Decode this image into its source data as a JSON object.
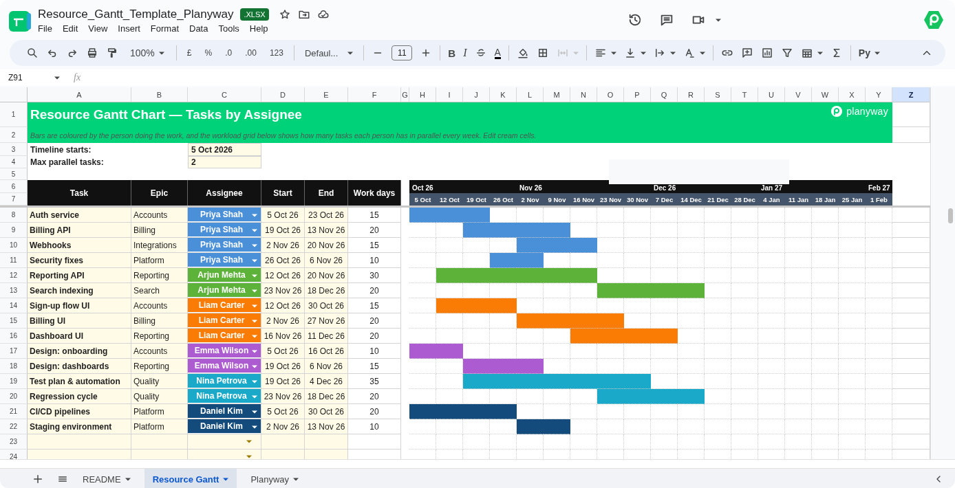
{
  "app": {
    "title": "Resource_Gantt_Template_Planyway",
    "badge": ".XLSX",
    "menu": [
      "File",
      "Edit",
      "View",
      "Insert",
      "Format",
      "Data",
      "Tools",
      "Help"
    ]
  },
  "toolbar": {
    "zoom": "100%",
    "currency": "£",
    "percent": "%",
    "decrease_decimals": ".0",
    "increase_decimals": ".00",
    "number_format": "123",
    "font": "Defaul...",
    "font_size": "11",
    "bold": "B",
    "italic": "I",
    "text_color": "A",
    "addon": "Py"
  },
  "formula_bar": {
    "cell": "Z91",
    "fx": "fx"
  },
  "columns": [
    {
      "label": "A",
      "selected": false
    },
    {
      "label": "B",
      "selected": false
    },
    {
      "label": "C",
      "selected": false
    },
    {
      "label": "D",
      "selected": false
    },
    {
      "label": "E",
      "selected": false
    },
    {
      "label": "F",
      "selected": false
    },
    {
      "label": "G",
      "selected": false
    },
    {
      "label": "H",
      "selected": false
    },
    {
      "label": "I",
      "selected": false
    },
    {
      "label": "J",
      "selected": false
    },
    {
      "label": "K",
      "selected": false
    },
    {
      "label": "L",
      "selected": false
    },
    {
      "label": "M",
      "selected": false
    },
    {
      "label": "N",
      "selected": false
    },
    {
      "label": "O",
      "selected": false
    },
    {
      "label": "P",
      "selected": false
    },
    {
      "label": "Q",
      "selected": false
    },
    {
      "label": "R",
      "selected": false
    },
    {
      "label": "S",
      "selected": false
    },
    {
      "label": "T",
      "selected": false
    },
    {
      "label": "U",
      "selected": false
    },
    {
      "label": "V",
      "selected": false
    },
    {
      "label": "W",
      "selected": false
    },
    {
      "label": "X",
      "selected": false
    },
    {
      "label": "Y",
      "selected": false
    },
    {
      "label": "Z",
      "selected": true
    }
  ],
  "row_numbers": [
    "1",
    "2",
    "3",
    "4",
    "5",
    "6",
    "7",
    "8",
    "9",
    "10",
    "11",
    "12",
    "13",
    "14",
    "15",
    "16",
    "17",
    "18",
    "19",
    "20",
    "21",
    "22",
    "23",
    "24"
  ],
  "sheet": {
    "title": "Resource Gantt Chart — Tasks by Assignee",
    "brand": "planyway",
    "subtitle": "Bars are coloured by the person doing the work, and the workload grid below shows how many tasks each person has in parallel every week. Edit cream cells.",
    "settings": [
      {
        "label": "Timeline starts:",
        "value": "5 Oct 2026"
      },
      {
        "label": "Max parallel tasks:",
        "value": "2"
      }
    ],
    "headers": [
      "Task",
      "Epic",
      "Assignee",
      "Start",
      "End",
      "Work days"
    ],
    "weeks": [
      {
        "label": "5 Oct",
        "month": "Oct 26"
      },
      {
        "label": "12 Oct"
      },
      {
        "label": "19 Oct"
      },
      {
        "label": "26 Oct"
      },
      {
        "label": "2 Nov",
        "month": "Nov 26"
      },
      {
        "label": "9 Nov"
      },
      {
        "label": "16 Nov"
      },
      {
        "label": "23 Nov"
      },
      {
        "label": "30 Nov"
      },
      {
        "label": "7 Dec",
        "month": "Dec 26"
      },
      {
        "label": "14 Dec"
      },
      {
        "label": "21 Dec"
      },
      {
        "label": "28 Dec"
      },
      {
        "label": "4 Jan",
        "month": "Jan 27"
      },
      {
        "label": "11 Jan"
      },
      {
        "label": "18 Jan"
      },
      {
        "label": "25 Jan"
      },
      {
        "label": "1 Feb",
        "month": "Feb 27"
      }
    ],
    "tasks": [
      {
        "kind": "task",
        "task": "Auth service",
        "epic": "Accounts",
        "assignee": "Priya Shah",
        "color": "#4a90d9",
        "start": "5 Oct 26",
        "end": "23 Oct 26",
        "work_days": "15",
        "bar": [
          true,
          true,
          true,
          false,
          false,
          false,
          false,
          false,
          false,
          false,
          false,
          false,
          false,
          false,
          false,
          false,
          false,
          false
        ]
      },
      {
        "kind": "task",
        "task": "Billing API",
        "epic": "Billing",
        "assignee": "Priya Shah",
        "color": "#4a90d9",
        "start": "19 Oct 26",
        "end": "13 Nov 26",
        "work_days": "20",
        "bar": [
          false,
          false,
          true,
          true,
          true,
          true,
          false,
          false,
          false,
          false,
          false,
          false,
          false,
          false,
          false,
          false,
          false,
          false
        ]
      },
      {
        "kind": "task",
        "task": "Webhooks",
        "epic": "Integrations",
        "assignee": "Priya Shah",
        "color": "#4a90d9",
        "start": "2 Nov 26",
        "end": "20 Nov 26",
        "work_days": "15",
        "bar": [
          false,
          false,
          false,
          false,
          true,
          true,
          true,
          false,
          false,
          false,
          false,
          false,
          false,
          false,
          false,
          false,
          false,
          false
        ]
      },
      {
        "kind": "task",
        "task": "Security fixes",
        "epic": "Platform",
        "assignee": "Priya Shah",
        "color": "#4a90d9",
        "start": "26 Oct 26",
        "end": "6 Nov 26",
        "work_days": "10",
        "bar": [
          false,
          false,
          false,
          true,
          true,
          false,
          false,
          false,
          false,
          false,
          false,
          false,
          false,
          false,
          false,
          false,
          false,
          false
        ]
      },
      {
        "kind": "task",
        "task": "Reporting API",
        "epic": "Reporting",
        "assignee": "Arjun Mehta",
        "color": "#5db33a",
        "start": "12 Oct 26",
        "end": "20 Nov 26",
        "work_days": "30",
        "bar": [
          false,
          true,
          true,
          true,
          true,
          true,
          true,
          false,
          false,
          false,
          false,
          false,
          false,
          false,
          false,
          false,
          false,
          false
        ]
      },
      {
        "kind": "task",
        "task": "Search indexing",
        "epic": "Search",
        "assignee": "Arjun Mehta",
        "color": "#5db33a",
        "start": "23 Nov 26",
        "end": "18 Dec 26",
        "work_days": "20",
        "bar": [
          false,
          false,
          false,
          false,
          false,
          false,
          false,
          true,
          true,
          true,
          true,
          false,
          false,
          false,
          false,
          false,
          false,
          false
        ]
      },
      {
        "kind": "task",
        "task": "Sign-up flow UI",
        "epic": "Accounts",
        "assignee": "Liam Carter",
        "color": "#fb7c05",
        "start": "12 Oct 26",
        "end": "30 Oct 26",
        "work_days": "15",
        "bar": [
          false,
          true,
          true,
          true,
          false,
          false,
          false,
          false,
          false,
          false,
          false,
          false,
          false,
          false,
          false,
          false,
          false,
          false
        ]
      },
      {
        "kind": "task",
        "task": "Billing UI",
        "epic": "Billing",
        "assignee": "Liam Carter",
        "color": "#fb7c05",
        "start": "2 Nov 26",
        "end": "27 Nov 26",
        "work_days": "20",
        "bar": [
          false,
          false,
          false,
          false,
          true,
          true,
          true,
          true,
          false,
          false,
          false,
          false,
          false,
          false,
          false,
          false,
          false,
          false
        ]
      },
      {
        "kind": "task",
        "task": "Dashboard UI",
        "epic": "Reporting",
        "assignee": "Liam Carter",
        "color": "#fb7c05",
        "start": "16 Nov 26",
        "end": "11 Dec 26",
        "work_days": "20",
        "bar": [
          false,
          false,
          false,
          false,
          false,
          false,
          true,
          true,
          true,
          true,
          false,
          false,
          false,
          false,
          false,
          false,
          false,
          false
        ]
      },
      {
        "kind": "task",
        "task": "Design: onboarding",
        "epic": "Accounts",
        "assignee": "Emma Wilson",
        "color": "#ad5bd1",
        "start": "5 Oct 26",
        "end": "16 Oct 26",
        "work_days": "10",
        "bar": [
          true,
          true,
          false,
          false,
          false,
          false,
          false,
          false,
          false,
          false,
          false,
          false,
          false,
          false,
          false,
          false,
          false,
          false
        ]
      },
      {
        "kind": "task",
        "task": "Design: dashboards",
        "epic": "Reporting",
        "assignee": "Emma Wilson",
        "color": "#ad5bd1",
        "start": "19 Oct 26",
        "end": "6 Nov 26",
        "work_days": "15",
        "bar": [
          false,
          false,
          true,
          true,
          true,
          false,
          false,
          false,
          false,
          false,
          false,
          false,
          false,
          false,
          false,
          false,
          false,
          false
        ]
      },
      {
        "kind": "task",
        "task": "Test plan & automation",
        "epic": "Quality",
        "assignee": "Nina Petrova",
        "color": "#1aa9c8",
        "start": "19 Oct 26",
        "end": "4 Dec 26",
        "work_days": "35",
        "bar": [
          false,
          false,
          true,
          true,
          true,
          true,
          true,
          true,
          true,
          false,
          false,
          false,
          false,
          false,
          false,
          false,
          false,
          false
        ]
      },
      {
        "kind": "task",
        "task": "Regression cycle",
        "epic": "Quality",
        "assignee": "Nina Petrova",
        "color": "#1aa9c8",
        "start": "23 Nov 26",
        "end": "18 Dec 26",
        "work_days": "20",
        "bar": [
          false,
          false,
          false,
          false,
          false,
          false,
          false,
          true,
          true,
          true,
          true,
          false,
          false,
          false,
          false,
          false,
          false,
          false
        ]
      },
      {
        "kind": "task",
        "task": "CI/CD pipelines",
        "epic": "Platform",
        "assignee": "Daniel Kim",
        "color": "#134b7d",
        "start": "5 Oct 26",
        "end": "30 Oct 26",
        "work_days": "20",
        "bar": [
          true,
          true,
          true,
          true,
          false,
          false,
          false,
          false,
          false,
          false,
          false,
          false,
          false,
          false,
          false,
          false,
          false,
          false
        ]
      },
      {
        "kind": "task",
        "task": "Staging environment",
        "epic": "Platform",
        "assignee": "Daniel Kim",
        "color": "#134b7d",
        "start": "2 Nov 26",
        "end": "13 Nov 26",
        "work_days": "10",
        "bar": [
          false,
          false,
          false,
          false,
          true,
          true,
          false,
          false,
          false,
          false,
          false,
          false,
          false,
          false,
          false,
          false,
          false,
          false
        ]
      },
      {
        "kind": "blank"
      },
      {
        "kind": "blank"
      }
    ]
  },
  "tabs": [
    {
      "label": "README",
      "selected": false
    },
    {
      "label": "Resource Gantt",
      "selected": true
    },
    {
      "label": "Planyway",
      "selected": false
    }
  ]
}
